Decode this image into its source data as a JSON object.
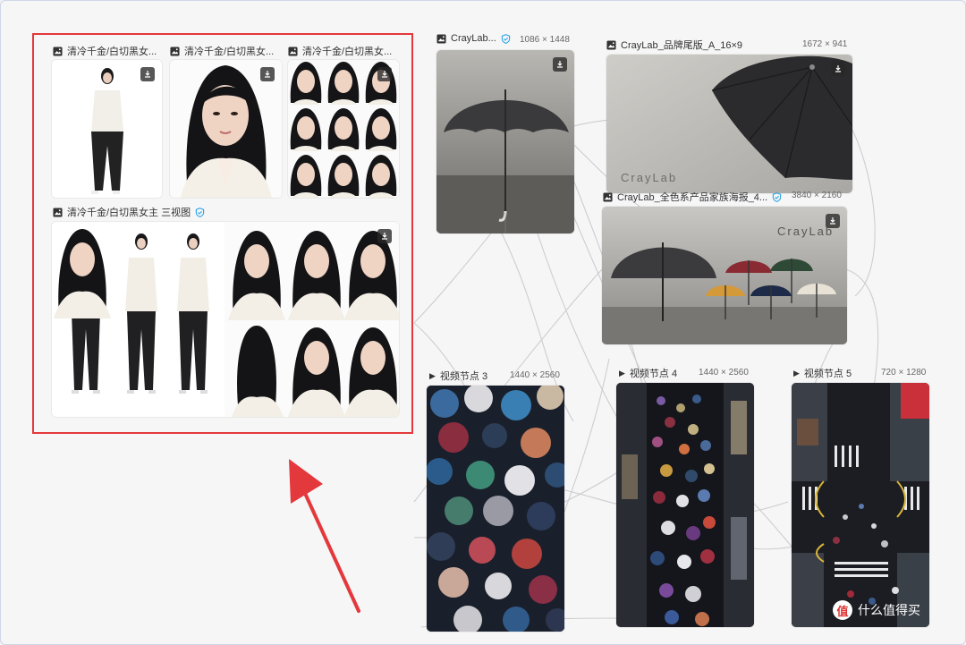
{
  "nodes": {
    "portrait_a": {
      "title": "清冷千金/白切黑女..."
    },
    "portrait_b": {
      "title": "清冷千金/白切黑女..."
    },
    "portrait_c": {
      "title": "清冷千金/白切黑女..."
    },
    "three_view": {
      "title": "清冷千金/白切黑女主 三视图"
    },
    "umbrella_a": {
      "title": "CrayLab...",
      "dims": "1086 × 1448"
    },
    "umbrella_b": {
      "title": "CrayLab_品牌尾版_A_16×9",
      "dims": "1672 × 941",
      "brand_mark": "CrayLab"
    },
    "umbrella_c": {
      "title": "CrayLab_全色系产品家族海报_4...",
      "dims": "3840 × 2160",
      "brand_mark": "CrayLab"
    },
    "video_3": {
      "title": "视频节点 3",
      "dims": "1440 × 2560"
    },
    "video_4": {
      "title": "视频节点 4",
      "dims": "1440 × 2560"
    },
    "video_5": {
      "title": "视频节点 5",
      "dims": "720 × 1280"
    }
  },
  "watermark": {
    "badge": "值",
    "text": "什么值得买"
  },
  "colors": {
    "highlight": "#e3383c",
    "verified": "#2aa3e6",
    "arrow": "#e3383c"
  }
}
